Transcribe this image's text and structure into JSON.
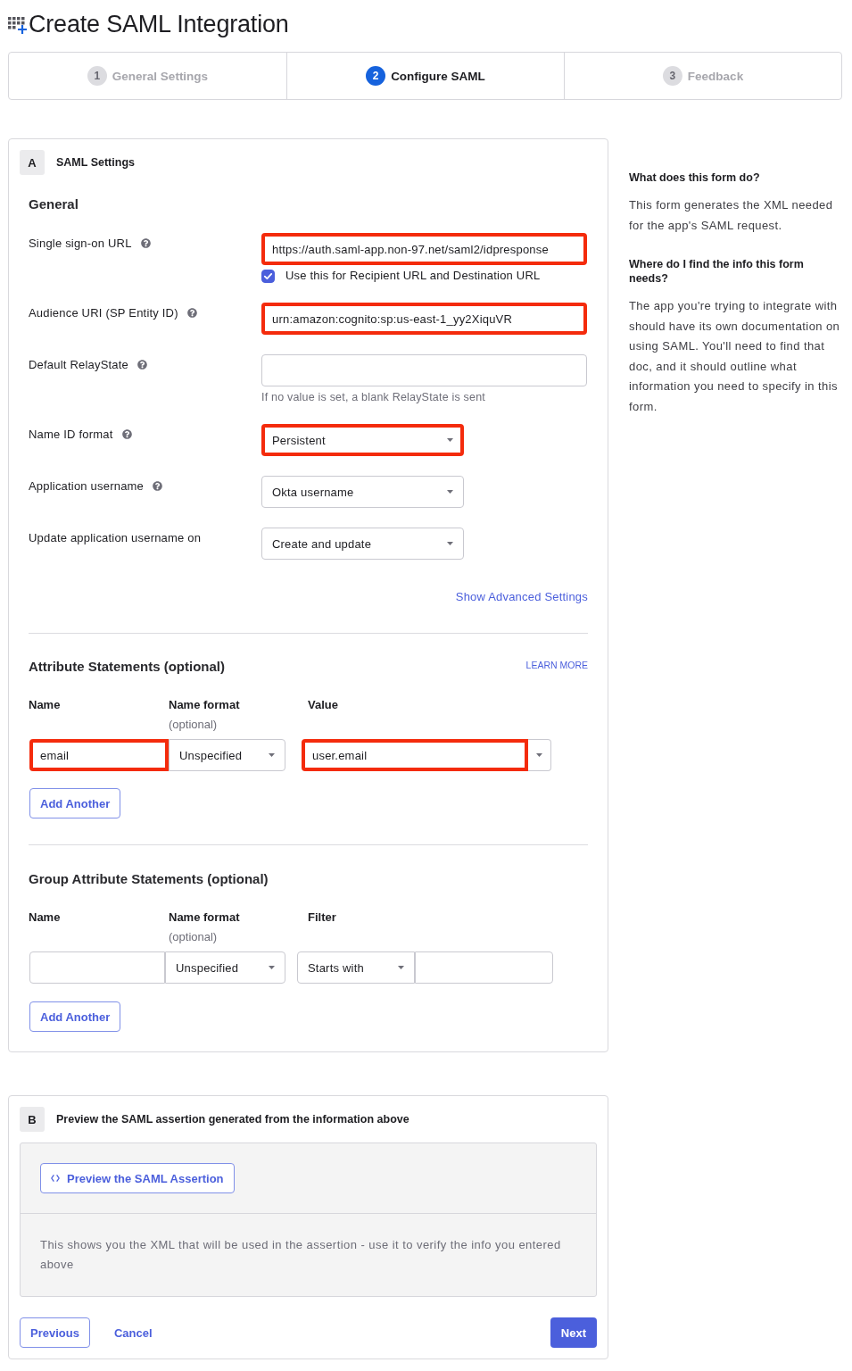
{
  "page": {
    "title": "Create SAML Integration"
  },
  "steps": [
    {
      "number": "1",
      "label": "General Settings",
      "selected": false
    },
    {
      "number": "2",
      "label": "Configure SAML",
      "selected": true
    },
    {
      "number": "3",
      "label": "Feedback",
      "selected": false
    }
  ],
  "saml_settings": {
    "badge": "A",
    "title": "SAML Settings",
    "general": {
      "heading": "General",
      "fields": [
        {
          "kind": "text",
          "label": "Single sign-on URL",
          "help": true,
          "value": "https://auth.saml-app.non-97.net/saml2/idpresponse",
          "highlighted": true,
          "checkbox": {
            "label": "Use this for Recipient URL and Destination URL",
            "checked": true
          }
        },
        {
          "kind": "text",
          "label": "Audience URI (SP Entity ID)",
          "help": true,
          "value": "urn:amazon:cognito:sp:us-east-1_yy2XiquVR",
          "highlighted": true
        },
        {
          "kind": "text",
          "label": "Default RelayState",
          "help": true,
          "hint": "If no value is set, a blank RelayState is sent",
          "highlighted": false
        },
        {
          "kind": "select",
          "label": "Name ID format",
          "help": true,
          "value": "Persistent",
          "highlighted": true
        },
        {
          "kind": "select",
          "label": "Application username",
          "help": true,
          "value": "Okta username",
          "highlighted": false
        },
        {
          "kind": "select",
          "label": "Update application username on",
          "help": false,
          "value": "Create and update",
          "highlighted": false
        }
      ],
      "advanced_link": "Show Advanced Settings"
    },
    "attribute_statements": {
      "heading": "Attribute Statements (optional)",
      "learn_more": "LEARN MORE",
      "columns": [
        {
          "label": "Name"
        },
        {
          "label": "Name format",
          "note": "(optional)"
        },
        {
          "label": "Value"
        }
      ],
      "rows": [
        {
          "name": {
            "value": "email",
            "highlighted": true
          },
          "name_format": {
            "value": "Unspecified",
            "highlighted": false
          },
          "value": {
            "value": "user.email",
            "highlighted": true
          }
        }
      ],
      "add_button": "Add Another"
    },
    "group_attribute_statements": {
      "heading": "Group Attribute Statements (optional)",
      "columns": [
        {
          "label": "Name"
        },
        {
          "label": "Name format",
          "note": "(optional)"
        },
        {
          "label": "Filter"
        }
      ],
      "rows": [
        {
          "name_format": "Unspecified",
          "filter": "Starts with"
        }
      ],
      "add_button": "Add Another"
    }
  },
  "preview": {
    "badge": "B",
    "title": "Preview the SAML assertion generated from the information above",
    "button": "Preview the SAML Assertion",
    "description": "This shows you the XML that will be used in the assertion - use it to verify the info you entered above"
  },
  "footer": {
    "previous": "Previous",
    "cancel": "Cancel",
    "next": "Next"
  },
  "help_panel": [
    {
      "heading": "What does this form do?",
      "text": "This form generates the XML needed for the app's SAML request."
    },
    {
      "heading": "Where do I find the info this form needs?",
      "text": "The app you're trying to integrate with should have its own documentation on using SAML. You'll need to find that doc, and it should outline what information you need to specify in this form."
    }
  ]
}
